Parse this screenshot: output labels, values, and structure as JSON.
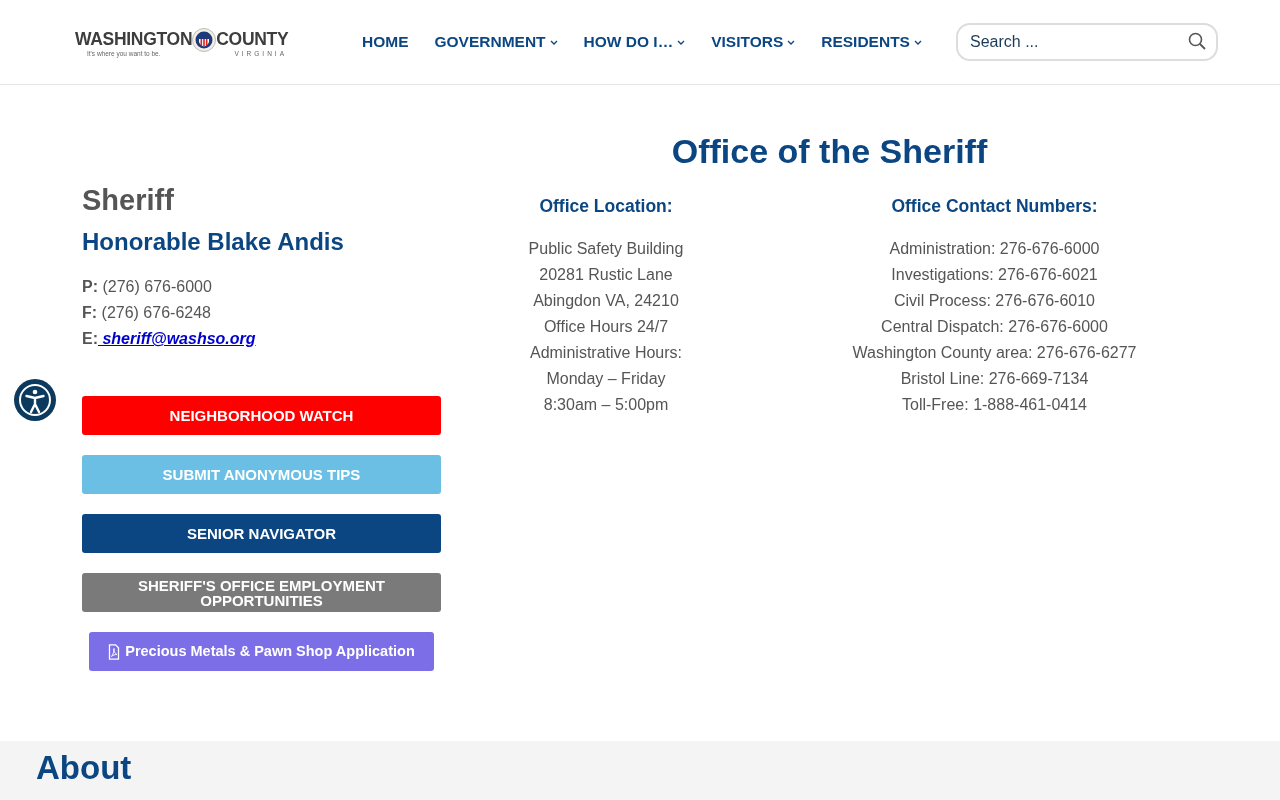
{
  "header": {
    "logo": {
      "name_left": "WASHINGTON",
      "name_right": "COUNTY",
      "tagline": "It's where you want to be.",
      "state": "VIRGINIA"
    },
    "nav": [
      {
        "label": "HOME",
        "dropdown": false
      },
      {
        "label": "GOVERNMENT",
        "dropdown": true
      },
      {
        "label": "HOW DO I…",
        "dropdown": true
      },
      {
        "label": "VISITORS",
        "dropdown": true
      },
      {
        "label": "RESIDENTS",
        "dropdown": true
      }
    ],
    "search": {
      "placeholder": "Search ..."
    }
  },
  "sheriff": {
    "heading": "Sheriff",
    "name": "Honorable Blake Andis",
    "contacts": [
      {
        "label": "P:",
        "value": "(276) 676-6000",
        "kind": "text"
      },
      {
        "label": "F:",
        "value": "(276) 676-6248",
        "kind": "text"
      },
      {
        "label": "E:",
        "value": " sheriff@washso.org",
        "kind": "link"
      }
    ],
    "buttons": [
      {
        "label": "NEIGHBORHOOD WATCH",
        "color": "#ff0000",
        "kind": "block"
      },
      {
        "label": "SUBMIT ANONYMOUS TIPS",
        "color": "#6cbfe4",
        "kind": "block"
      },
      {
        "label": "SENIOR NAVIGATOR",
        "color": "#0b4682",
        "kind": "block"
      },
      {
        "label": "SHERIFF'S OFFICE EMPLOYMENT OPPORTUNITIES",
        "color": "#7a7a7a",
        "kind": "block"
      },
      {
        "label": "Precious Metals & Pawn Shop Application",
        "color": "#7b6ee6",
        "kind": "file"
      }
    ]
  },
  "office": {
    "title": "Office of the Sheriff",
    "columns": [
      {
        "heading": "Office Location:",
        "lines": [
          "Public Safety Building",
          "20281 Rustic Lane",
          "Abingdon VA, 24210",
          "Office Hours 24/7",
          "Administrative Hours:",
          "Monday – Friday",
          "8:30am – 5:00pm"
        ]
      },
      {
        "heading": "Office Contact Numbers:",
        "lines": [
          "Administration: 276-676-6000",
          "Investigations: 276-676-6021",
          "Civil Process: 276-676-6010",
          "Central Dispatch: 276-676-6000",
          "Washington County area: 276-676-6277",
          "Bristol Line: 276-669-7134",
          "Toll-Free: 1-888-461-0414"
        ]
      }
    ]
  },
  "about": {
    "heading": "About"
  }
}
